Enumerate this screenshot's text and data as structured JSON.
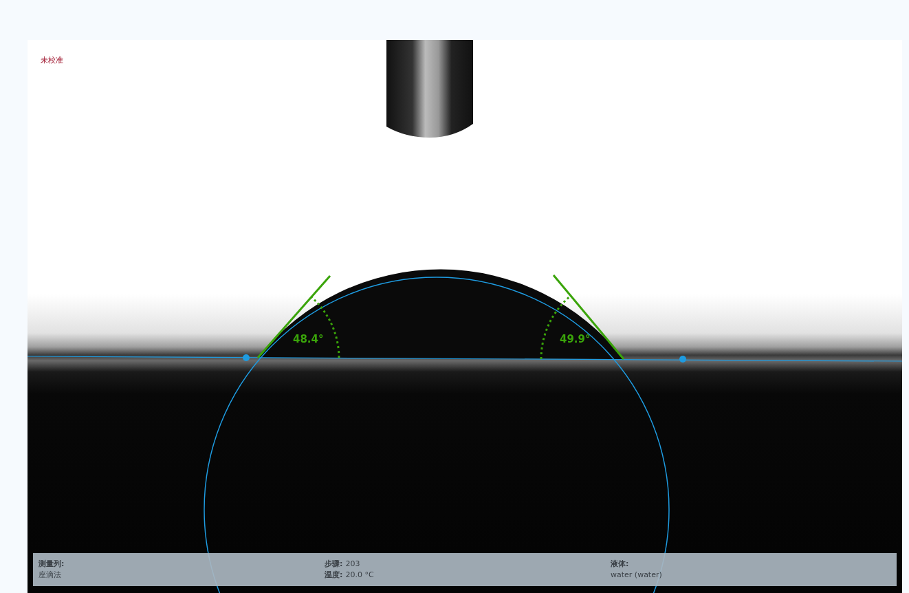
{
  "viewer": {
    "calibration_status": "未校准",
    "contact_angles": [
      "48.4°",
      "49.9°"
    ]
  },
  "info_bar": {
    "columns": [
      {
        "lines": [
          {
            "label": "测量列:"
          },
          {
            "value": "座滴法"
          }
        ]
      },
      {
        "lines": [
          {
            "label": "步骤:",
            "value": "203"
          },
          {
            "label": "温度:",
            "value": "20.0 °C"
          }
        ]
      },
      {
        "lines": [
          {
            "label": "液体:"
          },
          {
            "value": "water (water)"
          }
        ]
      }
    ]
  }
}
